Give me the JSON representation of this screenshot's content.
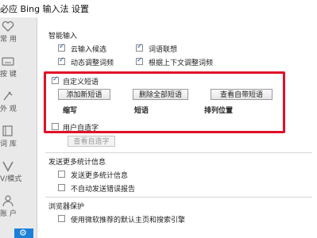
{
  "window": {
    "title": "必应 Bing 输入法 设置"
  },
  "sidebar": {
    "items": [
      {
        "label": "常 用",
        "icon": "heart-icon"
      },
      {
        "label": "按 键",
        "icon": "keyboard-icon"
      },
      {
        "label": "外 观",
        "icon": "brush-icon"
      },
      {
        "label": "词 库",
        "icon": "book-icon"
      },
      {
        "label": "V/模式",
        "icon": "v-mode-icon"
      },
      {
        "label": "账 户",
        "icon": "user-icon"
      },
      {
        "label": "",
        "icon": "gear-icon"
      }
    ]
  },
  "main": {
    "smart_input": {
      "heading": "智能输入",
      "options": [
        {
          "label": "云输入候选",
          "checked": true
        },
        {
          "label": "词语联想",
          "checked": true
        },
        {
          "label": "动态调整词频",
          "checked": true
        },
        {
          "label": "根据上下文调整词频",
          "checked": true
        }
      ]
    },
    "custom_phrases": {
      "label": "自定义短语",
      "checked": true,
      "buttons": {
        "add": "添加新短语",
        "delete_all": "删除全部短语",
        "view": "查看自带短语"
      },
      "columns": [
        "缩写",
        "短语",
        "排列位置"
      ]
    },
    "user_words": {
      "label": "用户自造字",
      "checked": false,
      "button": "查看自造字"
    },
    "stats": {
      "heading": "发送更多统计信息",
      "options": [
        {
          "label": "发送更多统计信息",
          "checked": false
        },
        {
          "label": "不自动发送错误报告",
          "checked": false
        }
      ]
    },
    "browser": {
      "heading": "浏览器保护",
      "options": [
        {
          "label": "使用微软推荐的默认主页和搜索引擎",
          "checked": false
        }
      ]
    }
  },
  "colors": {
    "highlight": "#e0102a",
    "accent": "#1e7fd8"
  }
}
